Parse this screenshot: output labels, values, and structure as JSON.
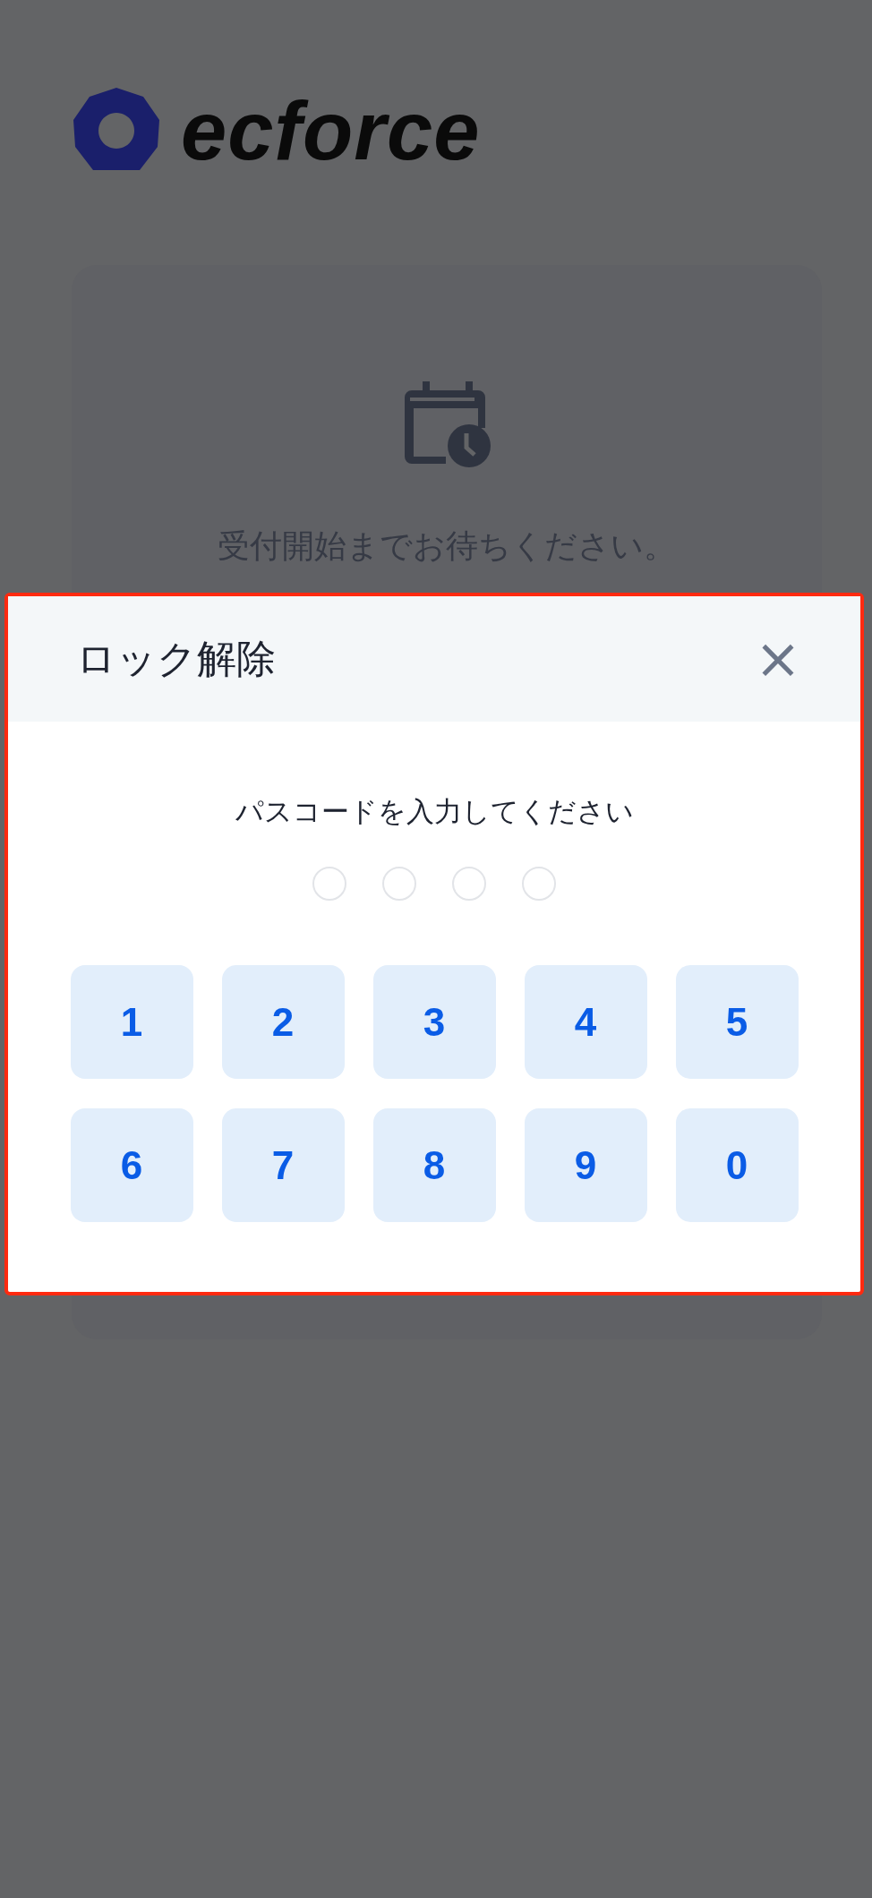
{
  "logo": {
    "text": "ecforce"
  },
  "card": {
    "message": "受付開始までお待ちください。"
  },
  "modal": {
    "title": "ロック解除",
    "close": "×",
    "prompt": "パスコードを入力してください",
    "dots": [
      {
        "filled": false
      },
      {
        "filled": false
      },
      {
        "filled": false
      },
      {
        "filled": false
      }
    ],
    "keys": [
      "1",
      "2",
      "3",
      "4",
      "5",
      "6",
      "7",
      "8",
      "9",
      "0"
    ]
  }
}
